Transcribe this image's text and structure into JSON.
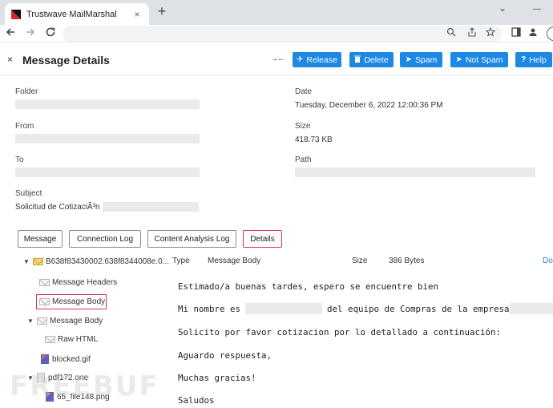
{
  "browser": {
    "tab_title": "Trustwave MailMarshal",
    "tab_close": "×",
    "new_tab": "+",
    "win_min": "⌄",
    "win_restore": "—"
  },
  "header": {
    "close": "×",
    "title": "Message Details",
    "collapse": "→←",
    "buttons": [
      {
        "icon": "✈",
        "label": "Release"
      },
      {
        "icon": "🗑",
        "label": "Delete"
      },
      {
        "icon": "➤",
        "label": "Spam"
      },
      {
        "icon": "➤",
        "label": "Not Spam"
      },
      {
        "icon": "?",
        "label": "Help"
      }
    ]
  },
  "fields": {
    "folder_label": "Folder",
    "date_label": "Date",
    "date_value": "Tuesday, December 6, 2022 12:00:36 PM",
    "from_label": "From",
    "size_label": "Size",
    "size_value": "418.73 KB",
    "to_label": "To",
    "path_label": "Path",
    "subject_label": "Subject",
    "subject_value": "Solicitud de CotizaciÃ³n"
  },
  "tabs": [
    "Message",
    "Connection Log",
    "Content Analysis Log",
    "Details"
  ],
  "tree": [
    "B638f83430002.638f8344008e.0...",
    "Message Headers",
    "Message Body",
    "Message Body",
    "Raw HTML",
    "blocked.gif",
    "pdf172.one",
    "65_file148.png"
  ],
  "detail": {
    "type_label": "Type",
    "type_value": "Message Body",
    "size_label": "Size",
    "size_value": "386 Bytes",
    "extra": "Do",
    "lines": [
      "Estimado/a buenas tardes, espero se encuentre bien",
      "Mi nombre es",
      "del equipo de Compras de la empresa",
      "Solicito por favor cotizacion por lo detallado a continuación:",
      "Aguardo respuesta,",
      "Muchas gracias!",
      "Saludos"
    ]
  },
  "watermark": "FREEBUF",
  "colors": {
    "accent": "#1e88e5",
    "highlight": "#d9364a"
  }
}
